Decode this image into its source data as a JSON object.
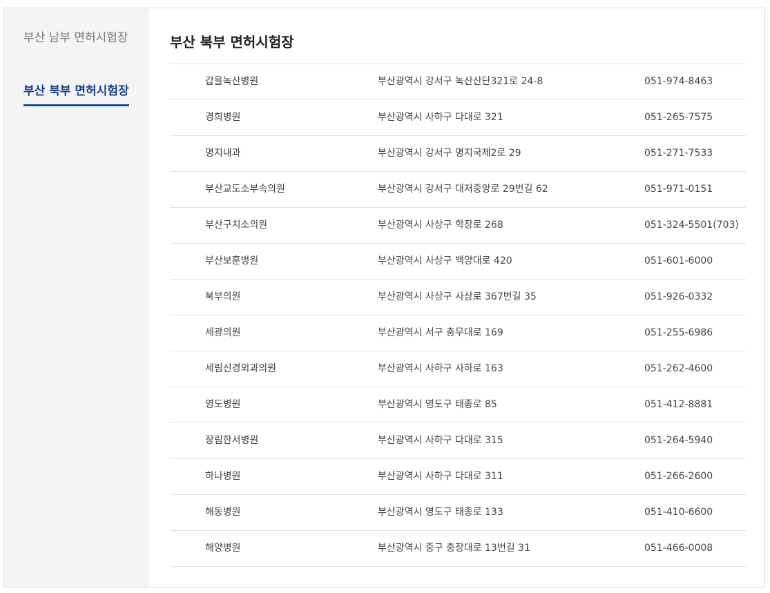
{
  "sidebar": {
    "items": [
      {
        "label": "부산 남부 면허시험장",
        "active": false
      },
      {
        "label": "부산 북부 면허시험장",
        "active": true
      }
    ]
  },
  "main": {
    "title": "부산 북부 면허시험장"
  },
  "hospitals": [
    {
      "name": "갑을녹산병원",
      "address": "부산광역시 강서구 녹산산단321로 24-8",
      "phone": "051-974-8463"
    },
    {
      "name": "경희병원",
      "address": "부산광역시 사하구 다대로 321",
      "phone": "051-265-7575"
    },
    {
      "name": "명지내과",
      "address": "부산광역시 강서구 명지국제2로 29",
      "phone": "051-271-7533"
    },
    {
      "name": "부산교도소부속의원",
      "address": "부산광역시 강서구 대저중앙로 29번길 62",
      "phone": "051-971-0151"
    },
    {
      "name": "부산구치소의원",
      "address": "부산광역시 사상구 학장로 268",
      "phone": "051-324-5501(703)"
    },
    {
      "name": "부산보훈병원",
      "address": "부산광역시 사상구 백양대로 420",
      "phone": "051-601-6000"
    },
    {
      "name": "북부의원",
      "address": "부산광역시 사상구 사상로 367번길 35",
      "phone": "051-926-0332"
    },
    {
      "name": "세광의원",
      "address": "부산광역시 서구 충무대로 169",
      "phone": "051-255-6986"
    },
    {
      "name": "세림신경외과의원",
      "address": "부산광역시 사하구 사하로 163",
      "phone": "051-262-4600"
    },
    {
      "name": "영도병원",
      "address": "부산광역시 영도구 태종로 85",
      "phone": "051-412-8881"
    },
    {
      "name": "장림한서병원",
      "address": "부산광역시 사하구 다대로 315",
      "phone": "051-264-5940"
    },
    {
      "name": "하나병원",
      "address": "부산광역시 사하구 다대로 311",
      "phone": "051-266-2600"
    },
    {
      "name": "해동병원",
      "address": "부산광역시 영도구 태종로 133",
      "phone": "051-410-6600"
    },
    {
      "name": "해양병원",
      "address": "부산광역시 중구 충장대로 13번길 31",
      "phone": "051-466-0008"
    }
  ],
  "colors": {
    "active_tab_text": "#1a3f87",
    "active_tab_underline": "#1a4ea8",
    "sidebar_bg": "#f4f4f4",
    "row_border": "#e2e2e2"
  }
}
